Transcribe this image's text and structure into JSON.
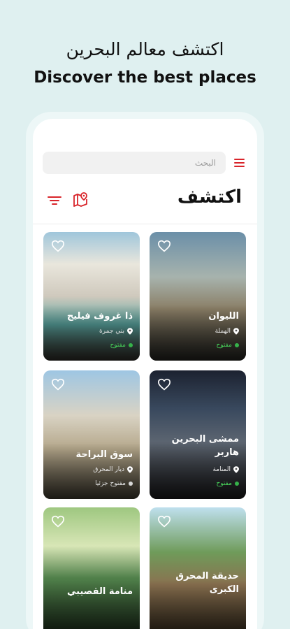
{
  "promo": {
    "title_ar": "اكتشف معالم البحرين",
    "title_en": "Discover the best places"
  },
  "search": {
    "placeholder": "البحث"
  },
  "header": {
    "title": "اكتشف"
  },
  "colors": {
    "accent": "#d9252b",
    "open_status": "#47d05a",
    "background": "#dff0f0"
  },
  "icons": {
    "menu": "hamburger-icon",
    "filter": "filter-icon",
    "map": "map-pin-icon",
    "favorite": "heart-icon",
    "location": "location-pin-icon"
  },
  "cards": [
    {
      "title": "الليوان",
      "location": "الهملة",
      "status": "مفتوح"
    },
    {
      "title": "ذا غروف فيليج",
      "location": "بني جمرة",
      "status": "مفتوح"
    },
    {
      "title": "ممشى البحرين هاربر",
      "location": "المنامة",
      "status": "مفتوح"
    },
    {
      "title": "سوق البراحة",
      "location": "ديار المحرق",
      "status": "مفتوح جزئيا"
    },
    {
      "title": "حديقة المحرق الكبرى",
      "location": "",
      "status": ""
    },
    {
      "title": "منامة القصيبي",
      "location": "",
      "status": ""
    }
  ]
}
